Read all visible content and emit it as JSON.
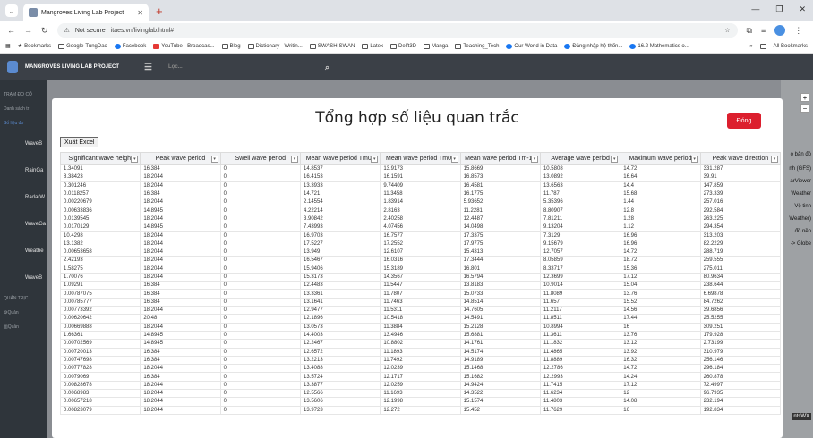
{
  "browser": {
    "tab_title": "Mangroves Living Lab Project",
    "url_security": "Not secure",
    "url": "itaes.vn/livinglab.html#",
    "bookmarks": [
      "Bookmarks",
      "Google-TungDao",
      "Facebook",
      "YouTube - Broadcas...",
      "Blog",
      "Dictionary - Writin...",
      "SWASH-SWAN",
      "Latex",
      "Delft3D",
      "Manga",
      "Teaching_Tech",
      "Our World in Data",
      "Đăng nhập hệ thốn...",
      "16.2 Mathematics o..."
    ],
    "all_bookmarks": "All Bookmarks"
  },
  "app": {
    "title": "MANGROVES LIVING LAB PROJECT",
    "menu_text": "Lọc...",
    "sidebar": [
      "TRẠM ĐO CỐ",
      "Danh sách tr",
      "Số liệu đo",
      "WaveB",
      "RainGa",
      "RadarW",
      "WaveGa",
      "Weathe",
      "WaveB",
      "QUẢN TRỊC",
      "Quản",
      "Quản"
    ],
    "right_items": [
      "o bản đồ",
      "nh (GFS)",
      "arViewer",
      "Weather",
      "Vệ tinh",
      "Weather)",
      "đồ nền",
      "-> Globe"
    ],
    "footer_badge": "ntsWX"
  },
  "modal": {
    "title": "Tổng hợp số liệu quan trắc",
    "close_label": "Đóng",
    "export_label": "Xuất Excel",
    "columns": [
      "Significant wave height",
      "Peak wave period",
      "Swell wave period",
      "Mean wave period Tm01",
      "Mean wave period Tm02",
      "Mean wave period Tm-10",
      "Average wave period",
      "Maximum wave period",
      "Peak wave direction"
    ],
    "rows": [
      [
        "1.34091",
        "16.384",
        "0",
        "14.8537",
        "13.9173",
        "15.8669",
        "10.5808",
        "14.72",
        "331.287"
      ],
      [
        "8.38423",
        "18.2044",
        "0",
        "16.4153",
        "16.1591",
        "16.8573",
        "13.0892",
        "16.64",
        "39.91"
      ],
      [
        "0.301246",
        "18.2044",
        "0",
        "13.3933",
        "9.74409",
        "16.4581",
        "13.6563",
        "14.4",
        "147.859"
      ],
      [
        "0.0118257",
        "16.384",
        "0",
        "14.721",
        "11.3458",
        "16.1775",
        "11.787",
        "15.68",
        "273.339"
      ],
      [
        "0.00220679",
        "18.2044",
        "0",
        "2.14554",
        "1.83914",
        "5.93652",
        "5.35396",
        "1.44",
        "257.016"
      ],
      [
        "0.00633836",
        "14.8945",
        "0",
        "4.22214",
        "2.8163",
        "11.2281",
        "8.80907",
        "12.8",
        "292.584"
      ],
      [
        "0.0139545",
        "18.2044",
        "0",
        "3.90842",
        "2.40258",
        "12.4487",
        "7.81211",
        "1.28",
        "263.225"
      ],
      [
        "0.0170129",
        "14.8945",
        "0",
        "7.43993",
        "4.07456",
        "14.0498",
        "9.13204",
        "1.12",
        "294.354"
      ],
      [
        "10.4298",
        "18.2044",
        "0",
        "16.9703",
        "16.7577",
        "17.3375",
        "7.3129",
        "16.96",
        "313.203"
      ],
      [
        "13.1382",
        "18.2044",
        "0",
        "17.5227",
        "17.2552",
        "17.9775",
        "9.15679",
        "16.96",
        "82.2229"
      ],
      [
        "0.00653658",
        "18.2044",
        "0",
        "13.949",
        "12.6107",
        "15.4313",
        "12.7057",
        "14.72",
        "288.719"
      ],
      [
        "2.42193",
        "18.2044",
        "0",
        "16.5467",
        "16.0316",
        "17.3444",
        "8.05859",
        "18.72",
        "259.555"
      ],
      [
        "1.58275",
        "18.2044",
        "0",
        "15.9406",
        "15.3189",
        "16.801",
        "8.33717",
        "15.36",
        "275.011"
      ],
      [
        "1.70076",
        "18.2044",
        "0",
        "15.3173",
        "14.3567",
        "16.5794",
        "12.3699",
        "17.12",
        "80.9634"
      ],
      [
        "1.09291",
        "16.384",
        "0",
        "12.4483",
        "11.5447",
        "13.8183",
        "10.9014",
        "15.04",
        "238.644"
      ],
      [
        "0.00787075",
        "16.384",
        "0",
        "13.3361",
        "11.7807",
        "15.0733",
        "11.8089",
        "13.76",
        "6.69878"
      ],
      [
        "0.00785777",
        "16.384",
        "0",
        "13.1641",
        "11.7463",
        "14.8514",
        "11.657",
        "15.52",
        "84.7262"
      ],
      [
        "0.00773392",
        "18.2044",
        "0",
        "12.9477",
        "11.5311",
        "14.7605",
        "11.2117",
        "14.56",
        "39.6856"
      ],
      [
        "0.00620642",
        "20.48",
        "0",
        "12.1896",
        "10.5418",
        "14.5491",
        "11.8511",
        "17.44",
        "25.5255"
      ],
      [
        "0.00669888",
        "18.2044",
        "0",
        "13.0573",
        "11.3884",
        "15.2128",
        "10.8994",
        "16",
        "309.251"
      ],
      [
        "1.66361",
        "14.8945",
        "0",
        "14.4003",
        "13.4946",
        "15.6881",
        "11.3611",
        "13.76",
        "179.928"
      ],
      [
        "0.00702569",
        "14.8945",
        "0",
        "12.2467",
        "10.8802",
        "14.1761",
        "11.1832",
        "13.12",
        "2.73199"
      ],
      [
        "0.00720013",
        "16.384",
        "0",
        "12.6572",
        "11.1893",
        "14.5174",
        "11.4865",
        "13.92",
        "310.979"
      ],
      [
        "0.00747698",
        "16.384",
        "0",
        "13.2213",
        "11.7492",
        "14.9189",
        "11.8889",
        "16.32",
        "256.146"
      ],
      [
        "0.00777828",
        "18.2044",
        "0",
        "13.4088",
        "12.0239",
        "15.1468",
        "12.2786",
        "14.72",
        "296.184"
      ],
      [
        "0.0079069",
        "16.384",
        "0",
        "13.5724",
        "12.1717",
        "15.1682",
        "12.2993",
        "14.24",
        "260.878"
      ],
      [
        "0.00828678",
        "18.2044",
        "0",
        "13.3877",
        "12.0259",
        "14.9424",
        "11.7415",
        "17.12",
        "72.4997"
      ],
      [
        "0.0068983",
        "18.2044",
        "0",
        "12.5566",
        "11.1693",
        "14.3522",
        "11.6234",
        "12",
        "96.7935"
      ],
      [
        "0.00657218",
        "18.2044",
        "0",
        "13.5606",
        "12.1998",
        "15.1574",
        "11.4803",
        "14.08",
        "232.194"
      ],
      [
        "0.00823079",
        "18.2044",
        "0",
        "13.9723",
        "12.272",
        "15.452",
        "11.7629",
        "16",
        "192.834"
      ]
    ]
  }
}
